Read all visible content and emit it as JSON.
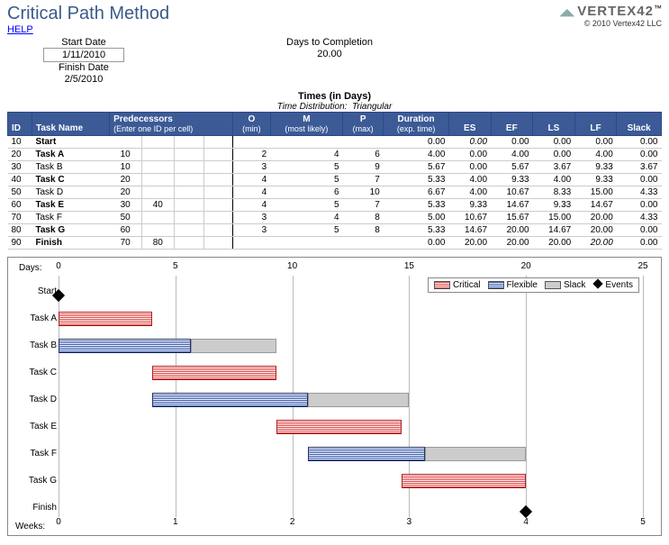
{
  "header": {
    "title": "Critical Path Method",
    "help": "HELP",
    "logo_brand": "VERTEX42",
    "logo_tm": "™",
    "copyright": "© 2010 Vertex42 LLC"
  },
  "meta": {
    "start_label": "Start Date",
    "start_value": "1/11/2010",
    "finish_label": "Finish Date",
    "finish_value": "2/5/2010",
    "days_label": "Days to Completion",
    "days_value": "20.00"
  },
  "times": {
    "title": "Times (in Days)",
    "sub_prefix": "Time Distribution:",
    "sub_value": "Triangular"
  },
  "columns": {
    "id": "ID",
    "name": "Task Name",
    "pred": "Predecessors",
    "pred_sub": "(Enter one ID per cell)",
    "o": "O",
    "o_sub": "(min)",
    "m": "M",
    "m_sub": "(most likely)",
    "p": "P",
    "p_sub": "(max)",
    "dur": "Duration",
    "dur_sub": "(exp. time)",
    "es": "ES",
    "ef": "EF",
    "ls": "LS",
    "lf": "LF",
    "slack": "Slack"
  },
  "tasks": [
    {
      "id": "10",
      "name": "Start",
      "bold": true,
      "pred": [
        "",
        "",
        "",
        ""
      ],
      "o": "",
      "m": "",
      "p": "",
      "dur": "0.00",
      "es": "0.00",
      "es_i": true,
      "ef": "0.00",
      "ls": "0.00",
      "lf": "0.00",
      "slack": "0.00"
    },
    {
      "id": "20",
      "name": "Task A",
      "bold": true,
      "pred": [
        "10",
        "",
        "",
        ""
      ],
      "o": "2",
      "m": "4",
      "p": "6",
      "dur": "4.00",
      "es": "0.00",
      "ef": "4.00",
      "ls": "0.00",
      "lf": "4.00",
      "slack": "0.00"
    },
    {
      "id": "30",
      "name": "Task B",
      "bold": false,
      "pred": [
        "10",
        "",
        "",
        ""
      ],
      "o": "3",
      "m": "5",
      "p": "9",
      "dur": "5.67",
      "es": "0.00",
      "ef": "5.67",
      "ls": "3.67",
      "lf": "9.33",
      "slack": "3.67"
    },
    {
      "id": "40",
      "name": "Task C",
      "bold": true,
      "pred": [
        "20",
        "",
        "",
        ""
      ],
      "o": "4",
      "m": "5",
      "p": "7",
      "dur": "5.33",
      "es": "4.00",
      "ef": "9.33",
      "ls": "4.00",
      "lf": "9.33",
      "slack": "0.00"
    },
    {
      "id": "50",
      "name": "Task D",
      "bold": false,
      "pred": [
        "20",
        "",
        "",
        ""
      ],
      "o": "4",
      "m": "6",
      "p": "10",
      "dur": "6.67",
      "es": "4.00",
      "ef": "10.67",
      "ls": "8.33",
      "lf": "15.00",
      "slack": "4.33"
    },
    {
      "id": "60",
      "name": "Task E",
      "bold": true,
      "pred": [
        "30",
        "40",
        "",
        ""
      ],
      "o": "4",
      "m": "5",
      "p": "7",
      "dur": "5.33",
      "es": "9.33",
      "ef": "14.67",
      "ls": "9.33",
      "lf": "14.67",
      "slack": "0.00"
    },
    {
      "id": "70",
      "name": "Task F",
      "bold": false,
      "pred": [
        "50",
        "",
        "",
        ""
      ],
      "o": "3",
      "m": "4",
      "p": "8",
      "dur": "5.00",
      "es": "10.67",
      "ef": "15.67",
      "ls": "15.00",
      "lf": "20.00",
      "slack": "4.33"
    },
    {
      "id": "80",
      "name": "Task G",
      "bold": true,
      "pred": [
        "60",
        "",
        "",
        ""
      ],
      "o": "3",
      "m": "5",
      "p": "8",
      "dur": "5.33",
      "es": "14.67",
      "ef": "20.00",
      "ls": "14.67",
      "lf": "20.00",
      "slack": "0.00"
    },
    {
      "id": "90",
      "name": "Finish",
      "bold": true,
      "pred": [
        "70",
        "80",
        "",
        ""
      ],
      "o": "",
      "m": "",
      "p": "",
      "dur": "0.00",
      "es": "20.00",
      "ef": "20.00",
      "ls": "20.00",
      "lf": "20.00",
      "lf_i": true,
      "slack": "0.00"
    }
  ],
  "chart": {
    "top_axis_label": "Days:",
    "bottom_axis_label": "Weeks:",
    "legend": {
      "critical": "Critical",
      "flexible": "Flexible",
      "slack": "Slack",
      "events": "Events"
    }
  },
  "chart_data": {
    "type": "gantt",
    "x_axis_days": {
      "min": 0,
      "max": 25,
      "ticks": [
        0,
        5,
        10,
        15,
        20,
        25
      ]
    },
    "x_axis_weeks": {
      "min": 0,
      "max": 5,
      "ticks": [
        0,
        1,
        2,
        3,
        4,
        5
      ]
    },
    "rows": [
      {
        "label": "Start",
        "type": "event",
        "at": 0
      },
      {
        "label": "Task A",
        "type": "critical",
        "es": 0.0,
        "ef": 4.0,
        "lf": 4.0
      },
      {
        "label": "Task B",
        "type": "flexible",
        "es": 0.0,
        "ef": 5.67,
        "lf": 9.33
      },
      {
        "label": "Task C",
        "type": "critical",
        "es": 4.0,
        "ef": 9.33,
        "lf": 9.33
      },
      {
        "label": "Task D",
        "type": "flexible",
        "es": 4.0,
        "ef": 10.67,
        "lf": 15.0
      },
      {
        "label": "Task E",
        "type": "critical",
        "es": 9.33,
        "ef": 14.67,
        "lf": 14.67
      },
      {
        "label": "Task F",
        "type": "flexible",
        "es": 10.67,
        "ef": 15.67,
        "lf": 20.0
      },
      {
        "label": "Task G",
        "type": "critical",
        "es": 14.67,
        "ef": 20.0,
        "lf": 20.0
      },
      {
        "label": "Finish",
        "type": "event",
        "at": 20
      }
    ]
  }
}
